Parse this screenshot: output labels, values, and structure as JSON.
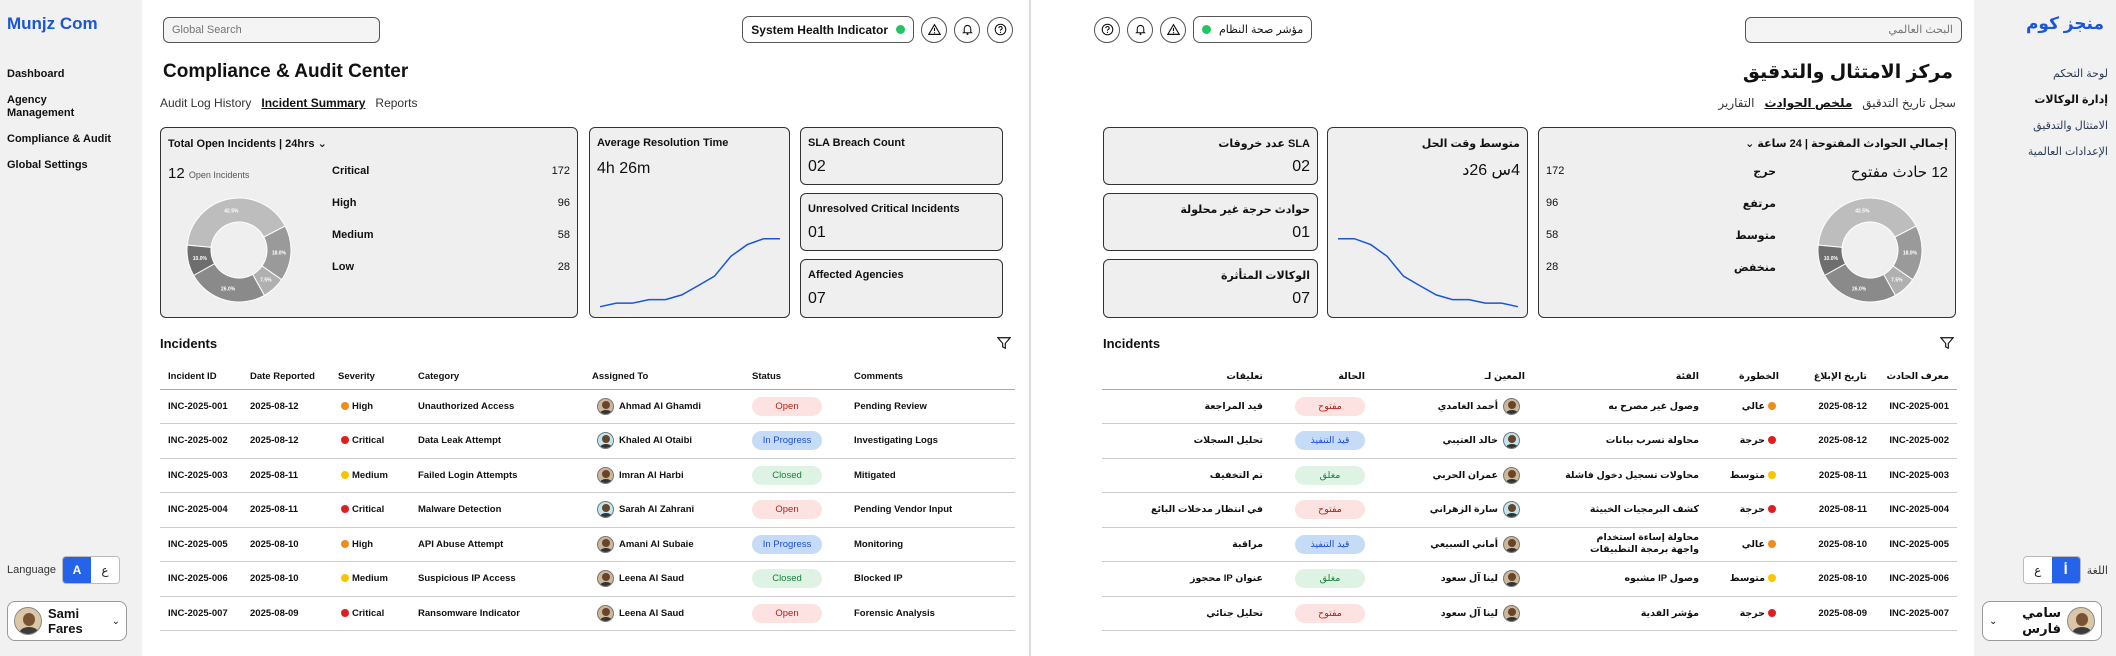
{
  "colors": {
    "accent": "#1a56d6",
    "critical": "#e11d1d",
    "high": "#f08c1a",
    "medium": "#f7c600",
    "open_bg": "#fde2e2",
    "progress_bg": "#c6dbf5",
    "closed_bg": "#dff3e4",
    "chart_line": "#1a56d6",
    "health_ok": "#22c55e"
  },
  "ltr": {
    "logo": "Munjz Com",
    "nav": [
      "Dashboard",
      "Agency Management",
      "Compliance & Audit",
      "Global Settings"
    ],
    "lang_label": "Language",
    "lang_a": "A",
    "lang_b": "ع",
    "user": "Sami Fares",
    "search_placeholder": "Global Search",
    "health": "System Health Indicator",
    "title": "Compliance & Audit Center",
    "tabs": [
      "Audit Log History",
      "Incident Summary",
      "Reports"
    ],
    "open_title": "Total Open Incidents | 24hrs",
    "open_count": "12",
    "open_label": "Open Incidents",
    "severities": [
      {
        "label": "Critical",
        "count": "172"
      },
      {
        "label": "High",
        "count": "96"
      },
      {
        "label": "Medium",
        "count": "58"
      },
      {
        "label": "Low",
        "count": "28"
      }
    ],
    "res_title": "Average Resolution Time",
    "res_value": "4h 26m",
    "sla_title": "SLA Breach Count",
    "sla_value": "02",
    "unres_title": "Unresolved Critical Incidents",
    "unres_value": "01",
    "agencies_title": "Affected Agencies",
    "agencies_value": "07",
    "incidents_title": "Incidents",
    "columns": [
      "Incident ID",
      "Date Reported",
      "Severity",
      "Category",
      "Assigned To",
      "Status",
      "Comments"
    ],
    "rows": [
      [
        "INC-2025-001",
        "2025-08-12",
        "High",
        "Unauthorized Access",
        "Ahmad Al Ghamdi",
        "Open",
        "Pending Review"
      ],
      [
        "INC-2025-002",
        "2025-08-12",
        "Critical",
        "Data Leak Attempt",
        "Khaled Al Otaibi",
        "In Progress",
        "Investigating Logs"
      ],
      [
        "INC-2025-003",
        "2025-08-11",
        "Medium",
        "Failed Login Attempts",
        "Imran Al Harbi",
        "Closed",
        "Mitigated"
      ],
      [
        "INC-2025-004",
        "2025-08-11",
        "Critical",
        "Malware Detection",
        "Sarah Al Zahrani",
        "Open",
        "Pending Vendor Input"
      ],
      [
        "INC-2025-005",
        "2025-08-10",
        "High",
        "API Abuse Attempt",
        "Amani Al Subaie",
        "In Progress",
        "Monitoring"
      ],
      [
        "INC-2025-006",
        "2025-08-10",
        "Medium",
        "Suspicious IP Access",
        "Leena Al Saud",
        "Closed",
        "Blocked IP"
      ],
      [
        "INC-2025-007",
        "2025-08-09",
        "Critical",
        "Ransomware Indicator",
        "Leena Al Saud",
        "Open",
        "Forensic Analysis"
      ]
    ]
  },
  "rtl": {
    "logo": "منجز كوم",
    "nav": [
      "لوحة التحكم",
      "إدارة الوكالات",
      "الامتثال والتدقيق",
      "الإعدادات العالمية"
    ],
    "lang_label": "اللغة",
    "lang_a": "أ",
    "lang_b": "ع",
    "user": "سامي فارس",
    "search_placeholder": "البحث العالمي",
    "health": "مؤشر صحة النظام",
    "title": "مركز الامتثال والتدقيق",
    "tabs": [
      "سجل تاريخ التدقيق",
      "ملخص الحوادث",
      "التقارير"
    ],
    "open_title": "إجمالي الحوادث المفتوحة | 24 ساعة",
    "open_count": "12 حادث مفتوح",
    "severities": [
      {
        "label": "حرج",
        "count": "172"
      },
      {
        "label": "مرتفع",
        "count": "96"
      },
      {
        "label": "متوسط",
        "count": "58"
      },
      {
        "label": "منخفض",
        "count": "28"
      }
    ],
    "res_title": "متوسط وقت الحل",
    "res_value": "4س 26د",
    "sla_title": "عدد خروقات SLA",
    "sla_value": "02",
    "unres_title": "حوادث حرجة غير محلولة",
    "unres_value": "01",
    "agencies_title": "الوكالات المتأثرة",
    "agencies_value": "07",
    "incidents_title": "Incidents",
    "columns": [
      "معرف الحادث",
      "تاريخ الإبلاغ",
      "الخطورة",
      "الفئة",
      "المعين لـ",
      "الحالة",
      "تعليقات"
    ],
    "rows": [
      [
        "INC-2025-001",
        "2025-08-12",
        "عالي",
        "وصول غير مصرح به",
        "أحمد الغامدي",
        "مفتوح",
        "قيد المراجعة"
      ],
      [
        "INC-2025-002",
        "2025-08-12",
        "حرجة",
        "محاولة تسرب بيانات",
        "خالد العتيبي",
        "قيد التنفيذ",
        "تحليل السجلات"
      ],
      [
        "INC-2025-003",
        "2025-08-11",
        "متوسط",
        "محاولات تسجيل دخول فاشلة",
        "عمران الحربي",
        "مغلق",
        "تم التخفيف"
      ],
      [
        "INC-2025-004",
        "2025-08-11",
        "حرجة",
        "كشف البرمجيات الخبيثة",
        "سارة الزهراني",
        "مفتوح",
        "في انتظار مدخلات البائع"
      ],
      [
        "INC-2025-005",
        "2025-08-10",
        "عالي",
        "محاولة إساءة استخدام واجهة برمجة التطبيقات",
        "أماني السبيعي",
        "قيد التنفيذ",
        "مراقبة"
      ],
      [
        "INC-2025-006",
        "2025-08-10",
        "متوسط",
        "وصول IP مشبوه",
        "لينا آل سعود",
        "مغلق",
        "عنوان IP محجوز"
      ],
      [
        "INC-2025-007",
        "2025-08-09",
        "حرجة",
        "مؤشر الفدية",
        "لينا آل سعود",
        "مفتوح",
        "تحليل جنائي"
      ]
    ]
  },
  "chart_data": [
    {
      "type": "pie",
      "title": "Total Open Incidents | 24hrs",
      "categories": [
        "Critical",
        "High",
        "Medium",
        "Low"
      ],
      "values": [
        42.5,
        18.0,
        7.5,
        26.0
      ],
      "extra_slice": 10.0,
      "labels": [
        "42.5%",
        "18.0%",
        "7.5%",
        "26.0%",
        "10.0%"
      ]
    },
    {
      "type": "line",
      "title": "Average Resolution Time",
      "x": [
        0,
        1,
        2,
        3,
        4,
        5,
        6,
        7,
        8,
        9,
        10,
        11
      ],
      "values": [
        2,
        5,
        5,
        8,
        8,
        12,
        20,
        28,
        45,
        55,
        60,
        60
      ],
      "ylim": [
        0,
        70
      ]
    }
  ]
}
